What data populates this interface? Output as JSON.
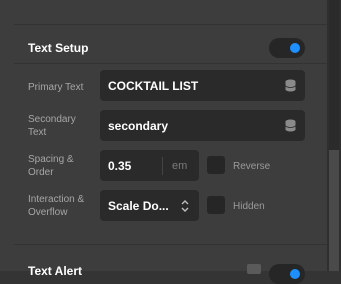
{
  "section": {
    "title": "Text Setup",
    "enabled": true
  },
  "rows": {
    "primary_text": {
      "label": "Primary Text",
      "value": "COCKTAIL LIST"
    },
    "secondary_text": {
      "label": "Secondary\nText",
      "value": "secondary"
    },
    "spacing_order": {
      "label": "Spacing &\nOrder",
      "value": "0.35",
      "unit": "em",
      "checkbox_label": "Reverse",
      "checked": false
    },
    "interaction_overflow": {
      "label": "Interaction &\nOverflow",
      "value": "Scale Do...",
      "checkbox_label": "Hidden",
      "checked": false
    }
  },
  "next_section": {
    "title": "Text Alert",
    "enabled": true
  },
  "colors": {
    "accent": "#1e8fff",
    "panel": "#3d3d3d",
    "field": "#2a2a2a"
  }
}
